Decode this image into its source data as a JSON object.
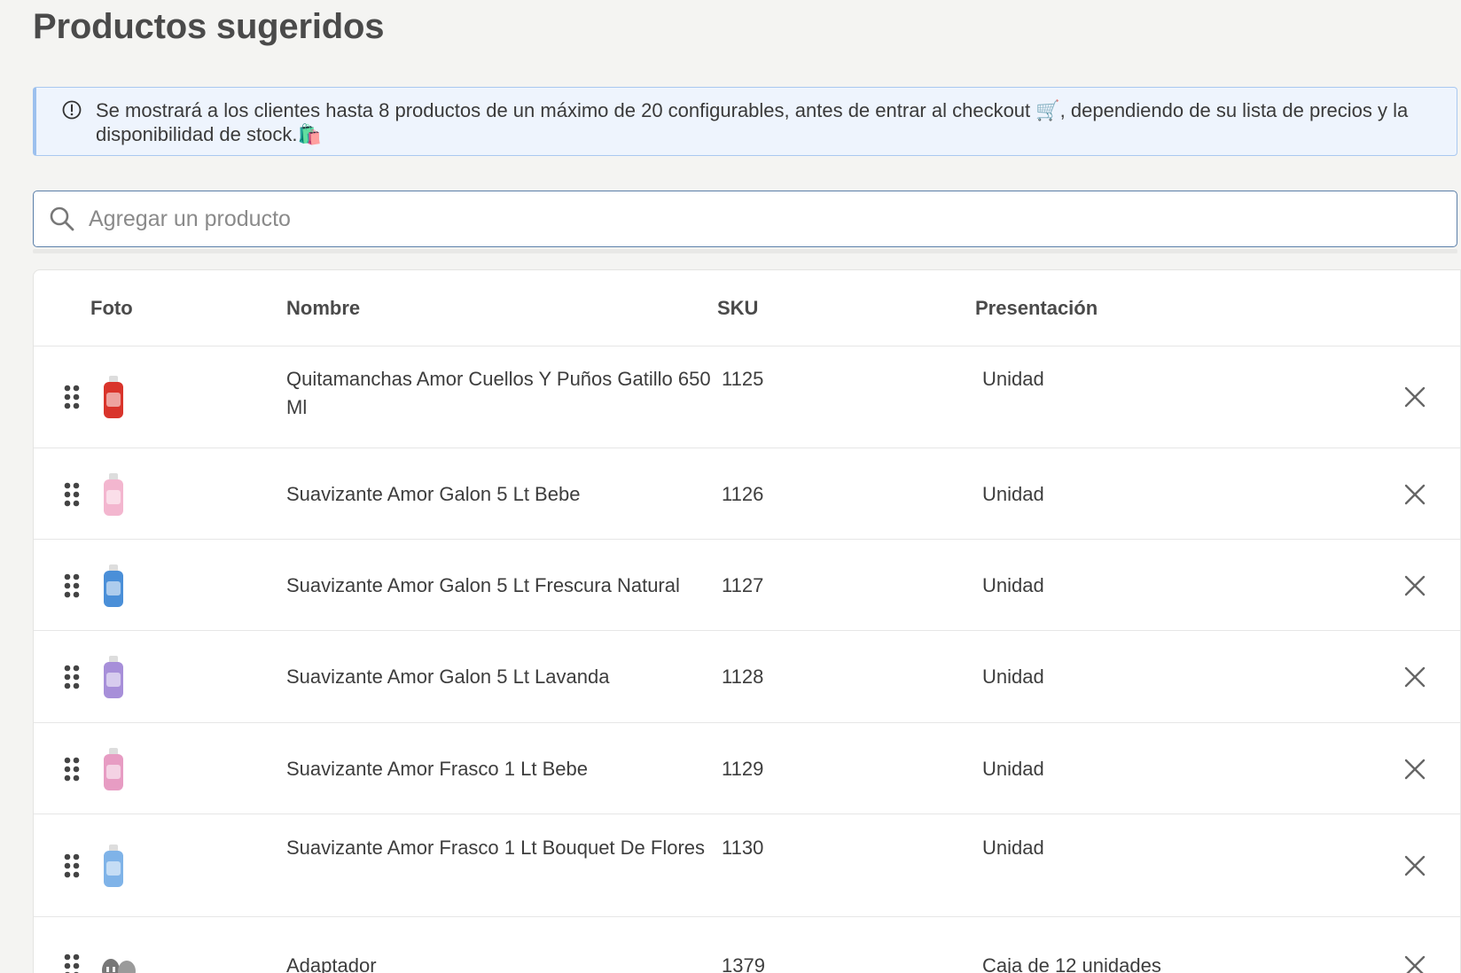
{
  "page": {
    "title": "Productos sugeridos"
  },
  "banner": {
    "icon": "info-circle-icon",
    "text": "Se mostrará a los clientes hasta 8 productos de un máximo de 20 configurables, antes de entrar al checkout 🛒, dependiendo de su lista de precios y la disponibilidad de stock.🛍️"
  },
  "search": {
    "placeholder": "Agregar un producto",
    "value": ""
  },
  "table": {
    "headers": {
      "photo": "Foto",
      "name": "Nombre",
      "sku": "SKU",
      "presentation": "Presentación"
    },
    "rows": [
      {
        "name": "Quitamanchas Amor Cuellos Y Puños Gatillo 650 Ml",
        "sku": "1125",
        "presentation": "Unidad",
        "thumb_color": "#d9342b"
      },
      {
        "name": "Suavizante Amor Galon 5 Lt Bebe",
        "sku": "1126",
        "presentation": "Unidad",
        "thumb_color": "#f3b6cf"
      },
      {
        "name": "Suavizante Amor Galon 5 Lt Frescura Natural",
        "sku": "1127",
        "presentation": "Unidad",
        "thumb_color": "#4a8fd8"
      },
      {
        "name": "Suavizante Amor Galon 5 Lt Lavanda",
        "sku": "1128",
        "presentation": "Unidad",
        "thumb_color": "#a78fd9"
      },
      {
        "name": "Suavizante Amor Frasco 1 Lt Bebe",
        "sku": "1129",
        "presentation": "Unidad",
        "thumb_color": "#e79cc3"
      },
      {
        "name": "Suavizante Amor Frasco 1 Lt Bouquet De Flores",
        "sku": "1130",
        "presentation": "Unidad",
        "thumb_color": "#7fb3e8"
      },
      {
        "name": "Adaptador",
        "sku": "1379",
        "presentation": "Caja de 12 unidades",
        "thumb_color": "#777777"
      }
    ]
  }
}
